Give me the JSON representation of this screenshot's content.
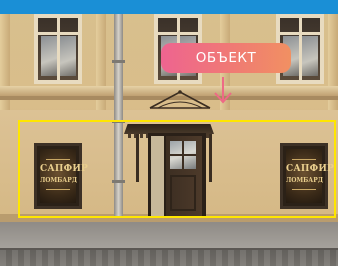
{
  "scene": {
    "description_colors": {
      "top_bar": "#1a8fd6",
      "highlight_border": "#ffe600",
      "label_gradient_start": "#ee6490",
      "label_gradient_end": "#f19062"
    }
  },
  "callout": {
    "label": "ОБЪЕКТ",
    "arrow_icon": "arrow-down-icon"
  },
  "signs": {
    "left": {
      "title": "САПФИР",
      "subtitle": "ЛОМБАРД"
    },
    "right": {
      "title": "САПФИР",
      "subtitle": "ЛОМБАРД"
    }
  }
}
